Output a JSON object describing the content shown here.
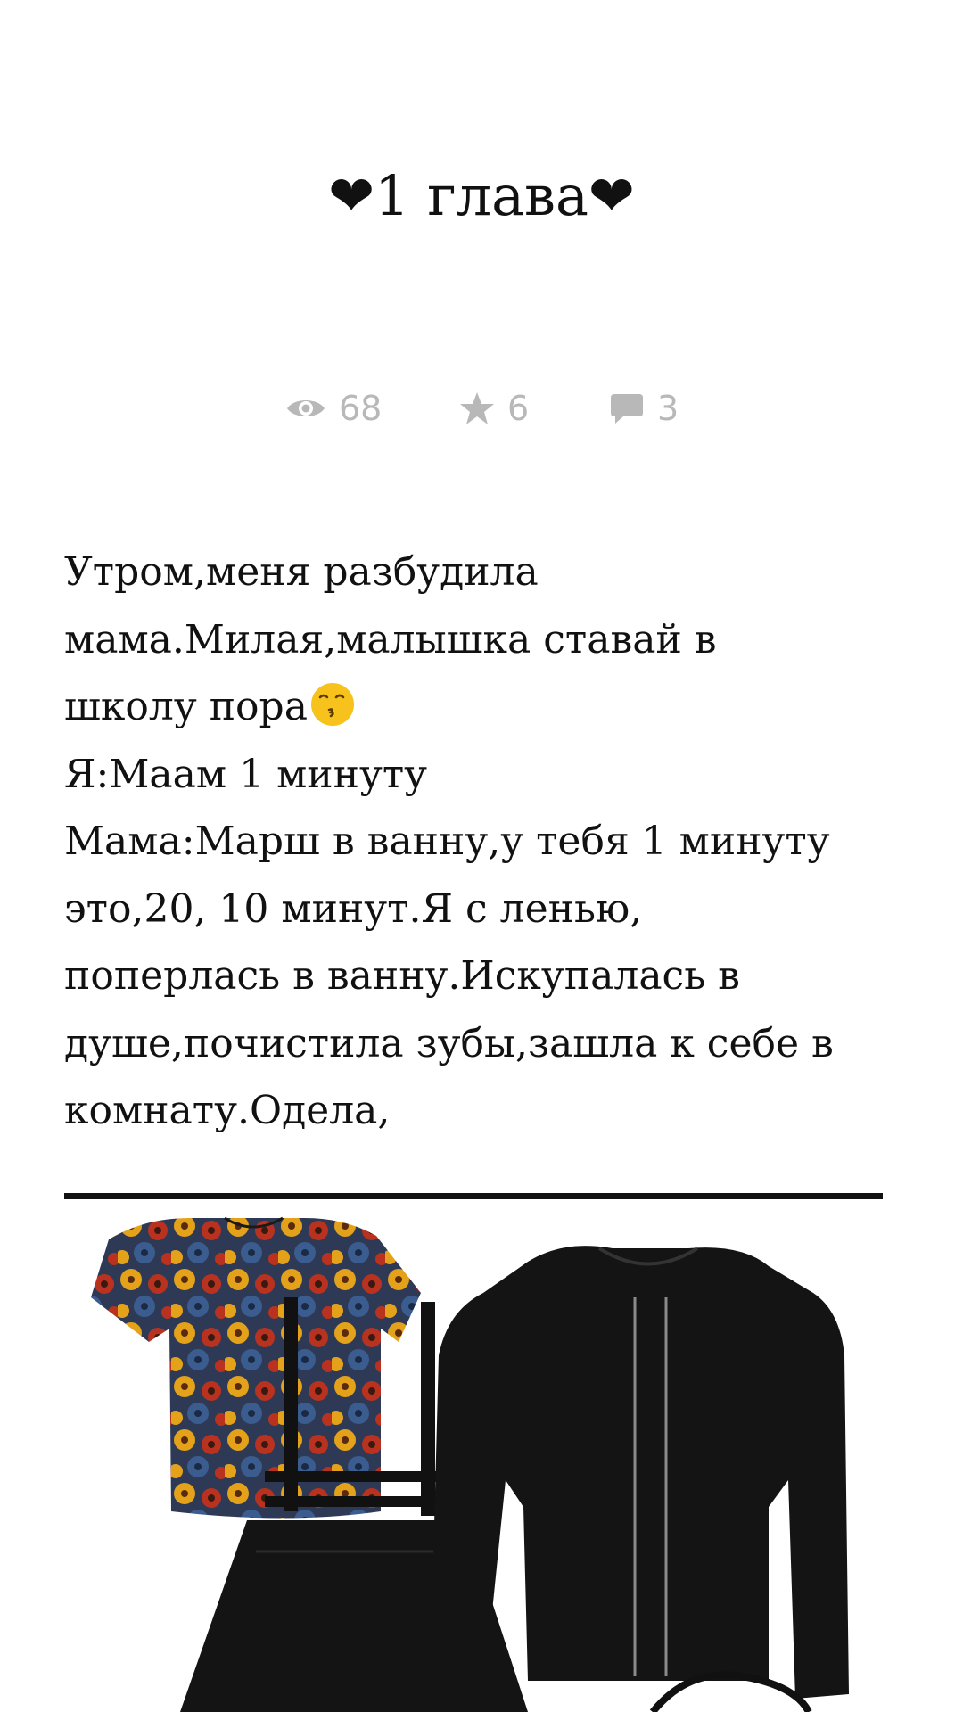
{
  "chapter": {
    "title": "❤1 глава❤"
  },
  "stats": {
    "views": "68",
    "stars": "6",
    "comments": "3"
  },
  "story": {
    "lines": [
      "Утром,меня разбудила",
      "мама.Милая,малышка ставай в",
      "школу пора",
      "Я:Маам 1 минуту",
      "Мама:Марш в ванну,у тебя 1 минуту",
      "это,20, 10 минут.Я с ленью,",
      "поперлась в ванну.Искупалась в",
      "душе,почистила зубы,зашла к себе в",
      "комнату.Одела,"
    ],
    "emoji": "kissing-face-emoji"
  },
  "colors": {
    "text": "#111111",
    "stat": "#b8b8b8",
    "background": "#ffffff"
  },
  "image": {
    "description_icon": "outfit-collage-image"
  }
}
